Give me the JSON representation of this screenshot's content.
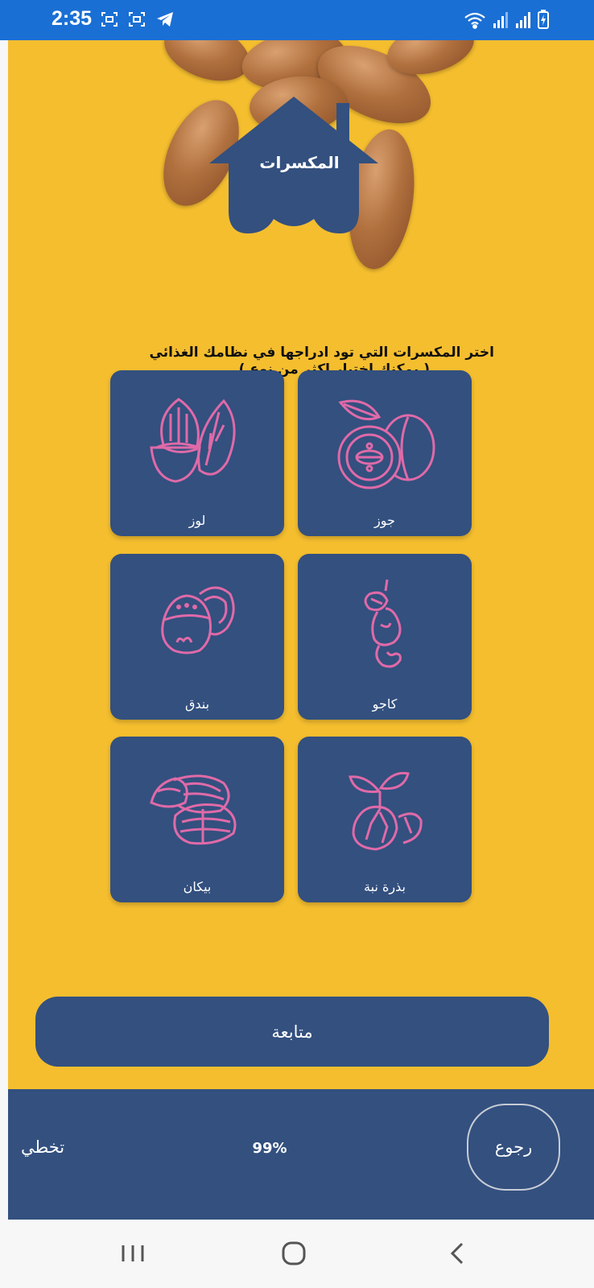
{
  "status_bar": {
    "time": "2:35",
    "icons": [
      "scan-icon",
      "scan-icon",
      "telegram-icon",
      "wifi-icon",
      "signal-icon",
      "signal-icon",
      "battery-icon"
    ]
  },
  "header": {
    "title": "المكسرات"
  },
  "prompt": {
    "line1": "اختر المكسرات التي تود ادراجها في نظامك الغذائي",
    "line2": "( يمكنك اختيار اكثر من نوع )"
  },
  "options": [
    {
      "label": "جوز",
      "icon": "walnut-icon"
    },
    {
      "label": "لوز",
      "icon": "almond-icon"
    },
    {
      "label": "كاجو",
      "icon": "cashew-icon"
    },
    {
      "label": "بندق",
      "icon": "hazelnut-icon"
    },
    {
      "label": "بذرة نبة",
      "icon": "seed-icon"
    },
    {
      "label": "بيكان",
      "icon": "pecan-icon"
    }
  ],
  "continue_label": "متابعة",
  "footer": {
    "skip_label": "تخطي",
    "progress": "99%",
    "back_label": "رجوع"
  },
  "colors": {
    "background": "#f5be2f",
    "primary": "#33507f",
    "icon_stroke": "#e06aa8",
    "status_bar": "#1a6fd4"
  },
  "nav": [
    "recent-apps-icon",
    "home-icon",
    "back-icon"
  ]
}
